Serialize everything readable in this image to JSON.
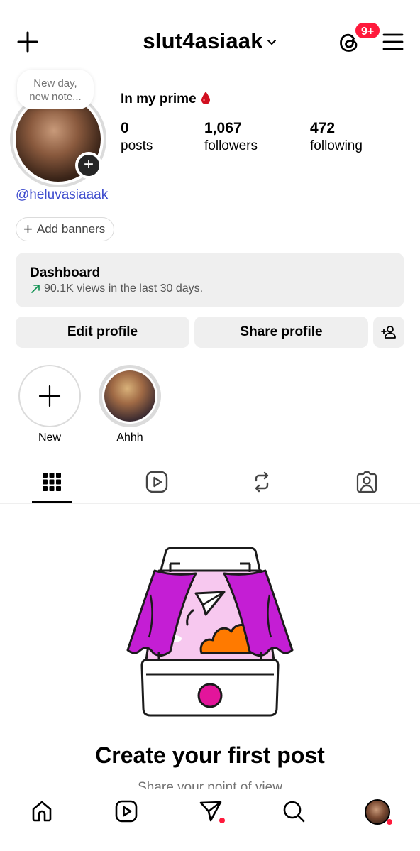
{
  "header": {
    "username": "slut4asiaak",
    "notification_badge": "9+"
  },
  "profile": {
    "note_placeholder": "New day, new note...",
    "note_line1": "New day,",
    "note_line2": "new note...",
    "name": "In my prime",
    "stats": [
      {
        "value": "0",
        "label": "posts"
      },
      {
        "value": "1,067",
        "label": "followers"
      },
      {
        "value": "472",
        "label": "following"
      }
    ],
    "threads_handle": "@heluvasiaaak",
    "add_banners_label": "Add banners"
  },
  "dashboard": {
    "title": "Dashboard",
    "subtitle": "90.1K views in the last 30 days."
  },
  "actions": {
    "edit_profile": "Edit profile",
    "share_profile": "Share profile"
  },
  "highlights": [
    {
      "label": "New"
    },
    {
      "label": "Ahhh"
    }
  ],
  "tabs": [
    "grid-icon",
    "reels-icon",
    "reposts-icon",
    "tagged-icon"
  ],
  "empty_state": {
    "title": "Create your first post",
    "subtitle": "Share your point of view"
  },
  "bottom_nav": [
    "home-icon",
    "reels-icon",
    "direct-message-icon",
    "search-icon",
    "profile-avatar"
  ],
  "colors": {
    "accent_red": "#ff1a3c",
    "link_blue": "#3f4dce",
    "surface_gray": "#efefef",
    "illustration_magenta": "#c41ed4",
    "illustration_orange": "#ff7a00",
    "illustration_pink": "#f7c8ef"
  }
}
